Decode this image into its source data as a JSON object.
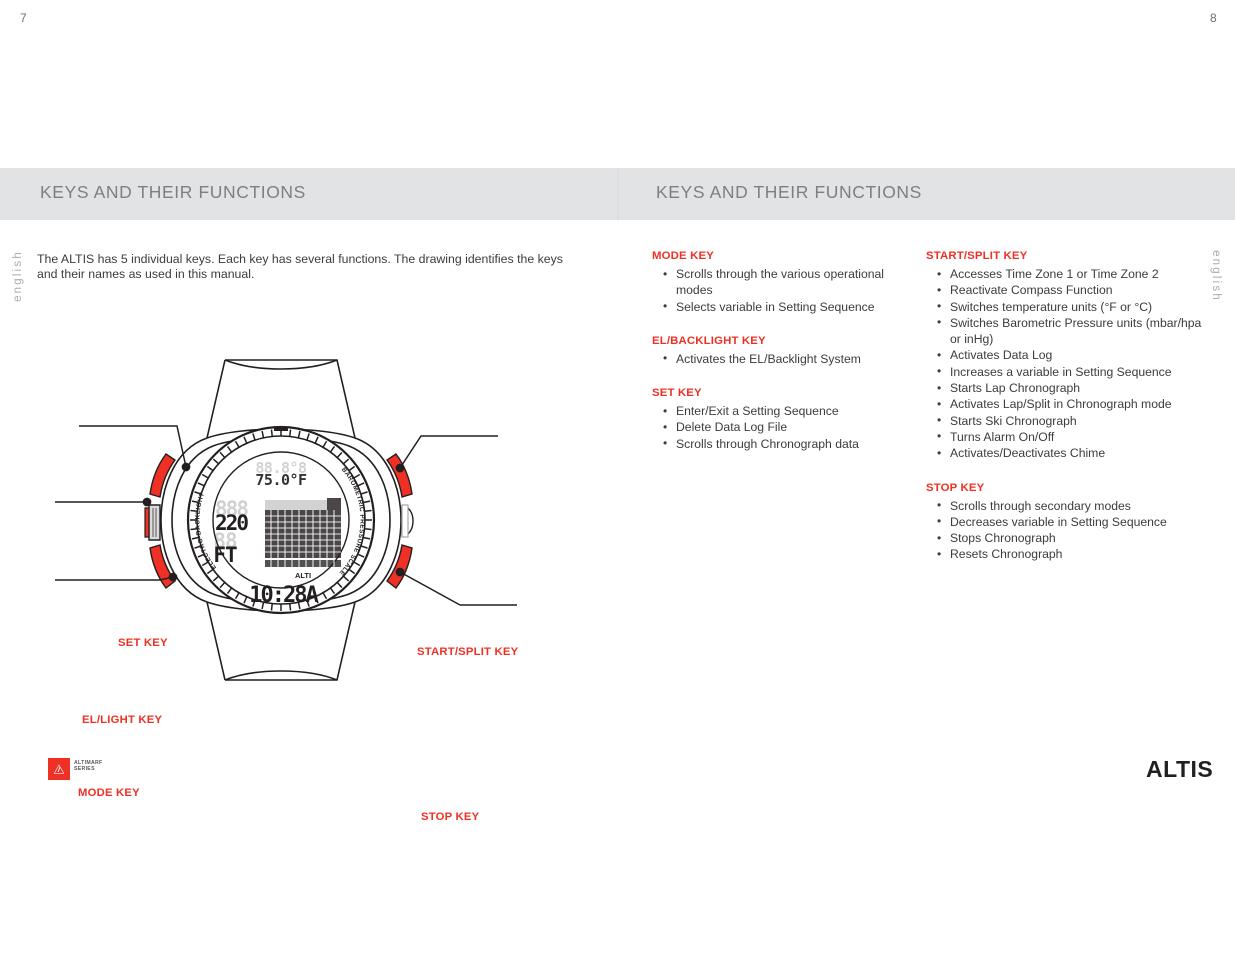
{
  "spread": {
    "left_page": {
      "header_title": "KEYS AND THEIR FUNCTIONS",
      "intro": "The ALTIS has 5 individual keys. Each key has several functions. The drawing identifies the keys and their names as used in this manual.",
      "page_number": "7",
      "language_tab": "english",
      "brand_badge_line1": "ALTIMARF",
      "brand_badge_line2": "SERIES"
    },
    "right_page": {
      "header_title": "KEYS AND THEIR FUNCTIONS",
      "page_number": "8",
      "language_tab": "english",
      "wordmark": "ALTIS"
    }
  },
  "diagram": {
    "callouts": [
      {
        "id": "set-key",
        "label": "SET KEY"
      },
      {
        "id": "el-light-key",
        "label": "EL/LIGHT KEY"
      },
      {
        "id": "mode-key",
        "label": "MODE KEY"
      },
      {
        "id": "start-split-key",
        "label": "START/SPLIT KEY"
      },
      {
        "id": "stop-key",
        "label": "STOP KEY"
      }
    ],
    "lcd": {
      "temperature": "75.0°F",
      "altitude_value": "220",
      "altitude_unit": "FT",
      "mode_label": "ALTI",
      "time": "10:28A"
    },
    "bezel": {
      "left_text": "ELECTRO-BACKLIGHT",
      "right_text": "BAROMETRIC PRESSURE SCALE"
    }
  },
  "key_functions": {
    "column_a": [
      {
        "heading": "MODE KEY",
        "items": [
          "Scrolls through the various operational modes",
          "Selects variable in Setting Sequence"
        ]
      },
      {
        "heading": "EL/BACKLIGHT KEY",
        "items": [
          "Activates the EL/Backlight System"
        ]
      },
      {
        "heading": "SET KEY",
        "items": [
          "Enter/Exit a Setting Sequence",
          "Delete Data Log File",
          "Scrolls through Chronograph data"
        ]
      }
    ],
    "column_b": [
      {
        "heading": "START/SPLIT KEY",
        "items": [
          "Accesses Time Zone 1 or Time Zone 2",
          "Reactivate Compass Function",
          "Switches temperature units (°F or °C)",
          "Switches Barometric Pressure units (mbar/hpa or inHg)",
          "Activates Data Log",
          "Increases a variable in Setting Sequence",
          "Starts Lap Chronograph",
          "Activates Lap/Split in Chronograph mode",
          "Starts Ski Chronograph",
          "Turns Alarm On/Off",
          "Activates/Deactivates Chime"
        ]
      },
      {
        "heading": "STOP KEY",
        "items": [
          "Scrolls through secondary modes",
          "Decreases variable in Setting Sequence",
          "Stops Chronograph",
          "Resets Chronograph"
        ]
      }
    ]
  },
  "colors": {
    "accent_red": "#ee3124",
    "header_band": "#e2e3e5",
    "header_text": "#7d7f83",
    "body_text": "#3c3c3e"
  }
}
